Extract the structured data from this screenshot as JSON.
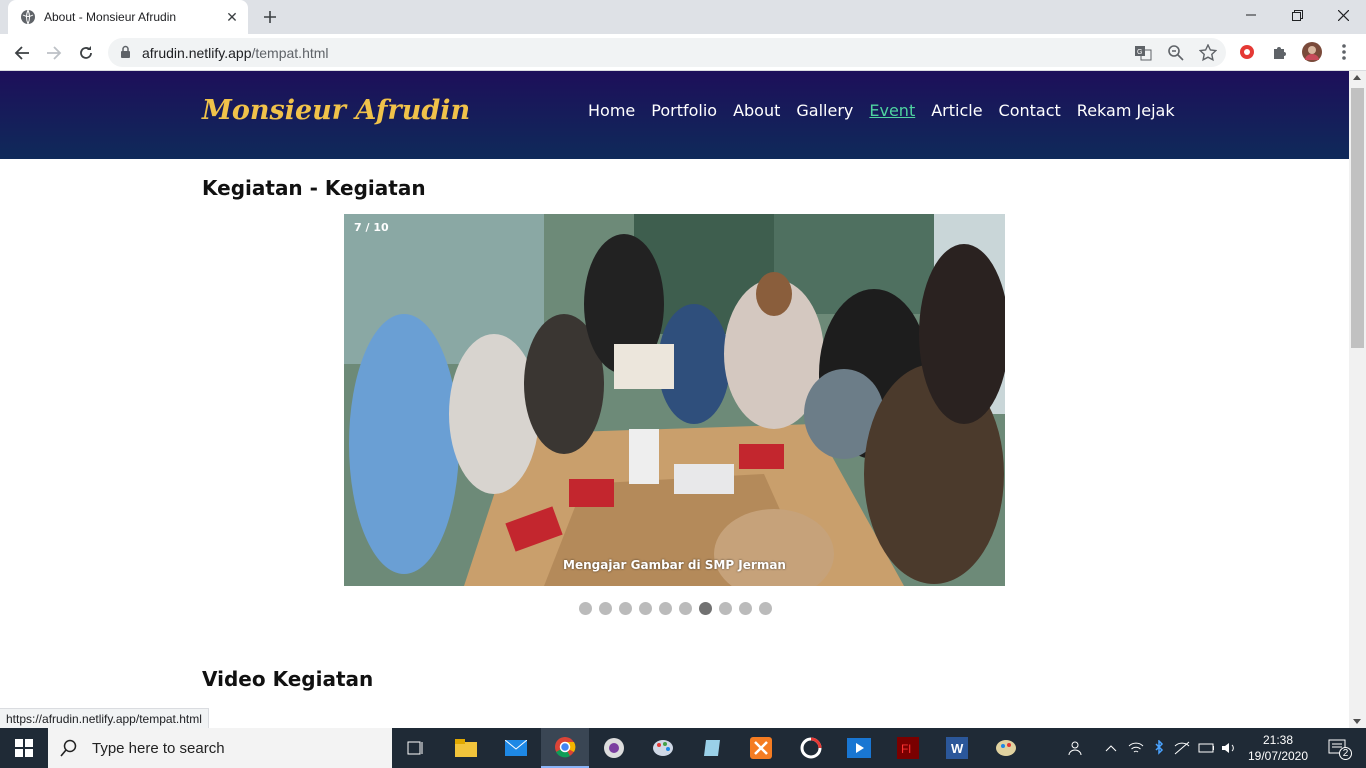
{
  "browser": {
    "tab_title": "About - Monsieur Afrudin",
    "url_host": "afrudin.netlify.app",
    "url_path": "/tempat.html",
    "status_url": "https://afrudin.netlify.app/tempat.html"
  },
  "site": {
    "brand": "Monsieur Afrudin",
    "nav": [
      "Home",
      "Portfolio",
      "About",
      "Gallery",
      "Event",
      "Article",
      "Contact",
      "Rekam Jejak"
    ],
    "active_nav": "Event",
    "colors": {
      "header_top": "#1d0f5a",
      "header_bottom": "#0f2a5a",
      "brand": "#f0c24a",
      "active_link": "#4fd3a0"
    }
  },
  "main": {
    "section1_title": "Kegiatan - Kegiatan",
    "slideshow": {
      "counter": "7 / 10",
      "caption": "Mengajar Gambar di SMP Jerman",
      "total": 10,
      "current": 7
    },
    "section2_title": "Video Kegiatan"
  },
  "taskbar": {
    "search_placeholder": "Type here to search",
    "time": "21:38",
    "date": "19/07/2020",
    "notification_count": "2",
    "apps": [
      "task-view",
      "file-explorer",
      "mail",
      "chrome",
      "media",
      "paint",
      "notepad",
      "xampp",
      "app-circle",
      "video",
      "flash",
      "word",
      "paint-brush"
    ]
  }
}
